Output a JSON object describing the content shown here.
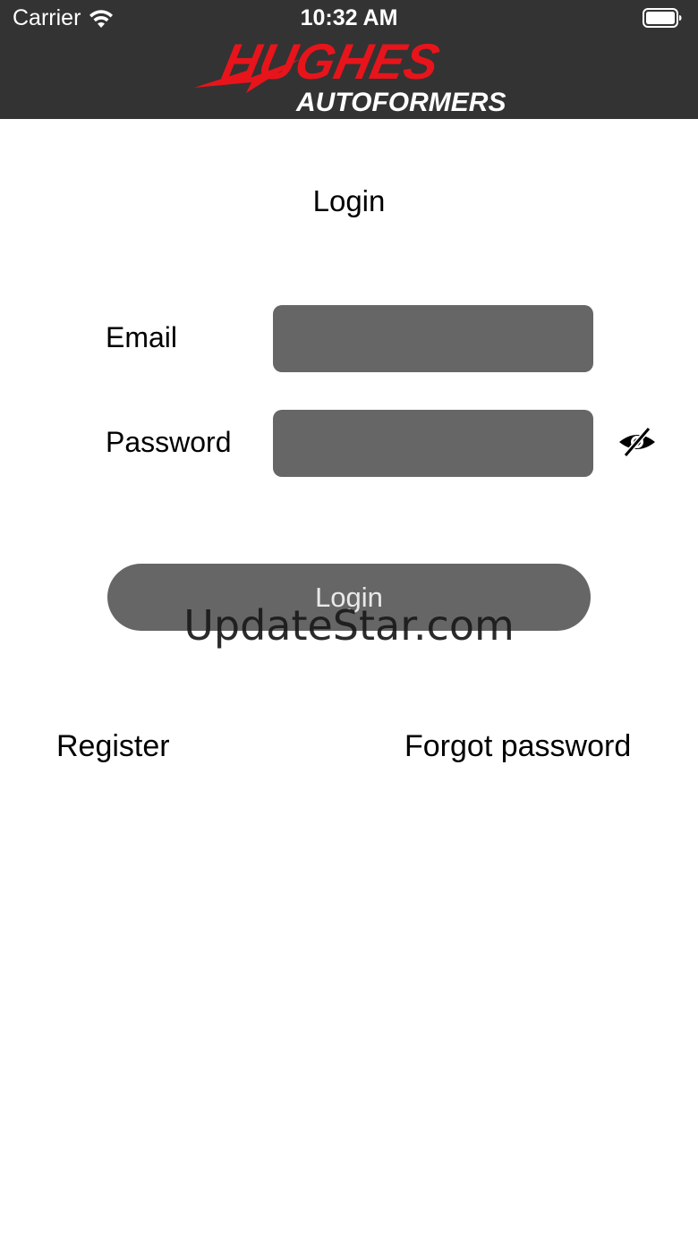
{
  "status_bar": {
    "carrier": "Carrier",
    "time": "10:32 AM",
    "wifi_icon": "wifi-icon",
    "battery_icon": "battery-full-icon"
  },
  "header": {
    "logo_line1": "HUGHES",
    "logo_line2": "AUTOFORMERS",
    "background_color": "#333333",
    "logo_color": "#e8141b"
  },
  "page": {
    "title": "Login"
  },
  "form": {
    "email_label": "Email",
    "email_value": "",
    "password_label": "Password",
    "password_value": "",
    "password_toggle_icon": "eye-slash-icon",
    "input_color": "#666666"
  },
  "actions": {
    "login_label": "Login",
    "register_label": "Register",
    "forgot_label": "Forgot password"
  },
  "watermark": {
    "text": "UpdateStar.com"
  }
}
